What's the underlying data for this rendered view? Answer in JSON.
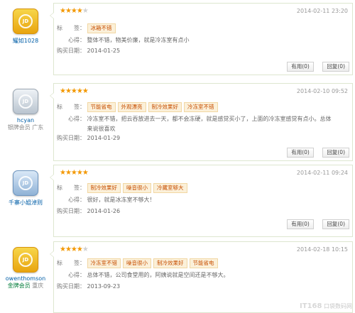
{
  "reviews": [
    {
      "user": {
        "name": "耀如1028",
        "level": "",
        "location": "",
        "avatar_color": "gold"
      },
      "rating": 4,
      "date": "2014-02-11 23:20",
      "labels": {
        "tags": "标　　签：",
        "comment": "心得：",
        "purchase": "购买日期："
      },
      "tags": [
        "冰箱不错"
      ],
      "comment": "整体不错，物美价廉，就是冷冻室有点小",
      "purchase_date": "2014-01-25",
      "buttons": {
        "useful": "有用(0)",
        "reply": "回复(0)"
      }
    },
    {
      "user": {
        "name": "hcyan",
        "level": "银牌会员",
        "location": "广东",
        "avatar_color": "silver"
      },
      "rating": 5,
      "date": "2014-02-10 09:52",
      "labels": {
        "tags": "标　　签：",
        "comment": "心得：",
        "purchase": "购买日期："
      },
      "tags": [
        "节能省电",
        "外观漂亮",
        "制冷效果好",
        "冷冻室不错"
      ],
      "comment": "冷冻室不错，把云吞放进去一天，都不会冻硬，就是感觉买小了，上面的冷冻室感觉有点小。总体来说很喜欢",
      "purchase_date": "2014-01-29",
      "buttons": {
        "useful": "有用(0)",
        "reply": "回复(0)"
      }
    },
    {
      "user": {
        "name": "千寨小姐淖则",
        "level": "",
        "location": "",
        "avatar_color": "blue"
      },
      "rating": 5,
      "date": "2014-02-11 09:24",
      "labels": {
        "tags": "标　　签：",
        "comment": "心得：",
        "purchase": "购买日期："
      },
      "tags": [
        "制冷效果好",
        "噪音很小",
        "冷藏室够大"
      ],
      "comment": "很好，就是冰冻室不够大！",
      "purchase_date": "2014-01-26",
      "buttons": {
        "useful": "有用(0)",
        "reply": "回复(0)"
      }
    },
    {
      "user": {
        "name": "owenthomson",
        "level": "金牌会员",
        "location": "重庆",
        "avatar_color": "gold"
      },
      "rating": 4,
      "date": "2014-02-18 10:15",
      "labels": {
        "tags": "标　　签：",
        "comment": "心得：",
        "purchase": "购买日期："
      },
      "tags": [
        "冷冻室不错",
        "噪音很小",
        "制冷效果好",
        "节能省电"
      ],
      "comment": "总体不错，公司食堂用的，阿姨说就是空间还是不够大。",
      "purchase_date": "2013-09-23",
      "buttons": {
        "useful": "有用(0)",
        "reply": "回复(0)"
      }
    }
  ],
  "watermark": {
    "logo": "IT168",
    "text": "口袋数码网"
  }
}
